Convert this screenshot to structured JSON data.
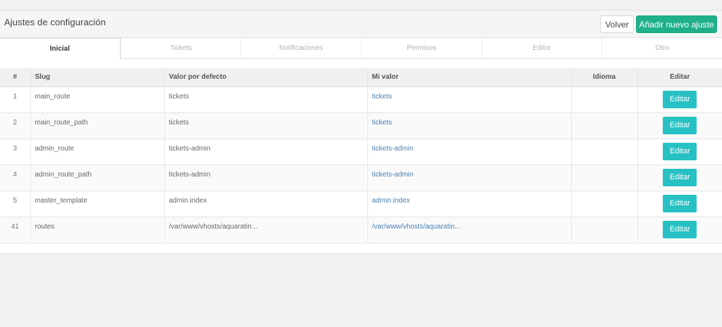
{
  "header": {
    "title": "Ajustes de configuración",
    "back_label": "Volver",
    "add_label": "Añadir nuevo ajuste"
  },
  "tabs": [
    {
      "label": "Inicial",
      "active": true
    },
    {
      "label": "Tickets",
      "active": false
    },
    {
      "label": "Notificaciones",
      "active": false
    },
    {
      "label": "Permisos",
      "active": false
    },
    {
      "label": "Editor",
      "active": false
    },
    {
      "label": "Otro",
      "active": false
    }
  ],
  "table": {
    "columns": [
      "#",
      "Slug",
      "Valor por defecto",
      "Mi valor",
      "Idioma",
      "Editar"
    ],
    "rows": [
      {
        "id": "1",
        "slug": "main_route",
        "default": "tickets",
        "mine": "tickets",
        "lang": "",
        "edit": "Editar"
      },
      {
        "id": "2",
        "slug": "main_route_path",
        "default": "tickets",
        "mine": "tickets",
        "lang": "",
        "edit": "Editar"
      },
      {
        "id": "3",
        "slug": "admin_route",
        "default": "tickets-admin",
        "mine": "tickets-admin",
        "lang": "",
        "edit": "Editar"
      },
      {
        "id": "4",
        "slug": "admin_route_path",
        "default": "tickets-admin",
        "mine": "tickets-admin",
        "lang": "",
        "edit": "Editar"
      },
      {
        "id": "5",
        "slug": "master_template",
        "default": "admin.index",
        "mine": "admin.index",
        "lang": "",
        "edit": "Editar"
      },
      {
        "id": "41",
        "slug": "routes",
        "default": "/var/www/vhosts/aquaratin...",
        "mine": "/var/www/vhosts/aquaratin...",
        "lang": "",
        "edit": "Editar"
      }
    ]
  },
  "colors": {
    "primary_green": "#1fb08b",
    "edit_teal": "#27c1c4",
    "link_blue": "#4a7fb0"
  }
}
